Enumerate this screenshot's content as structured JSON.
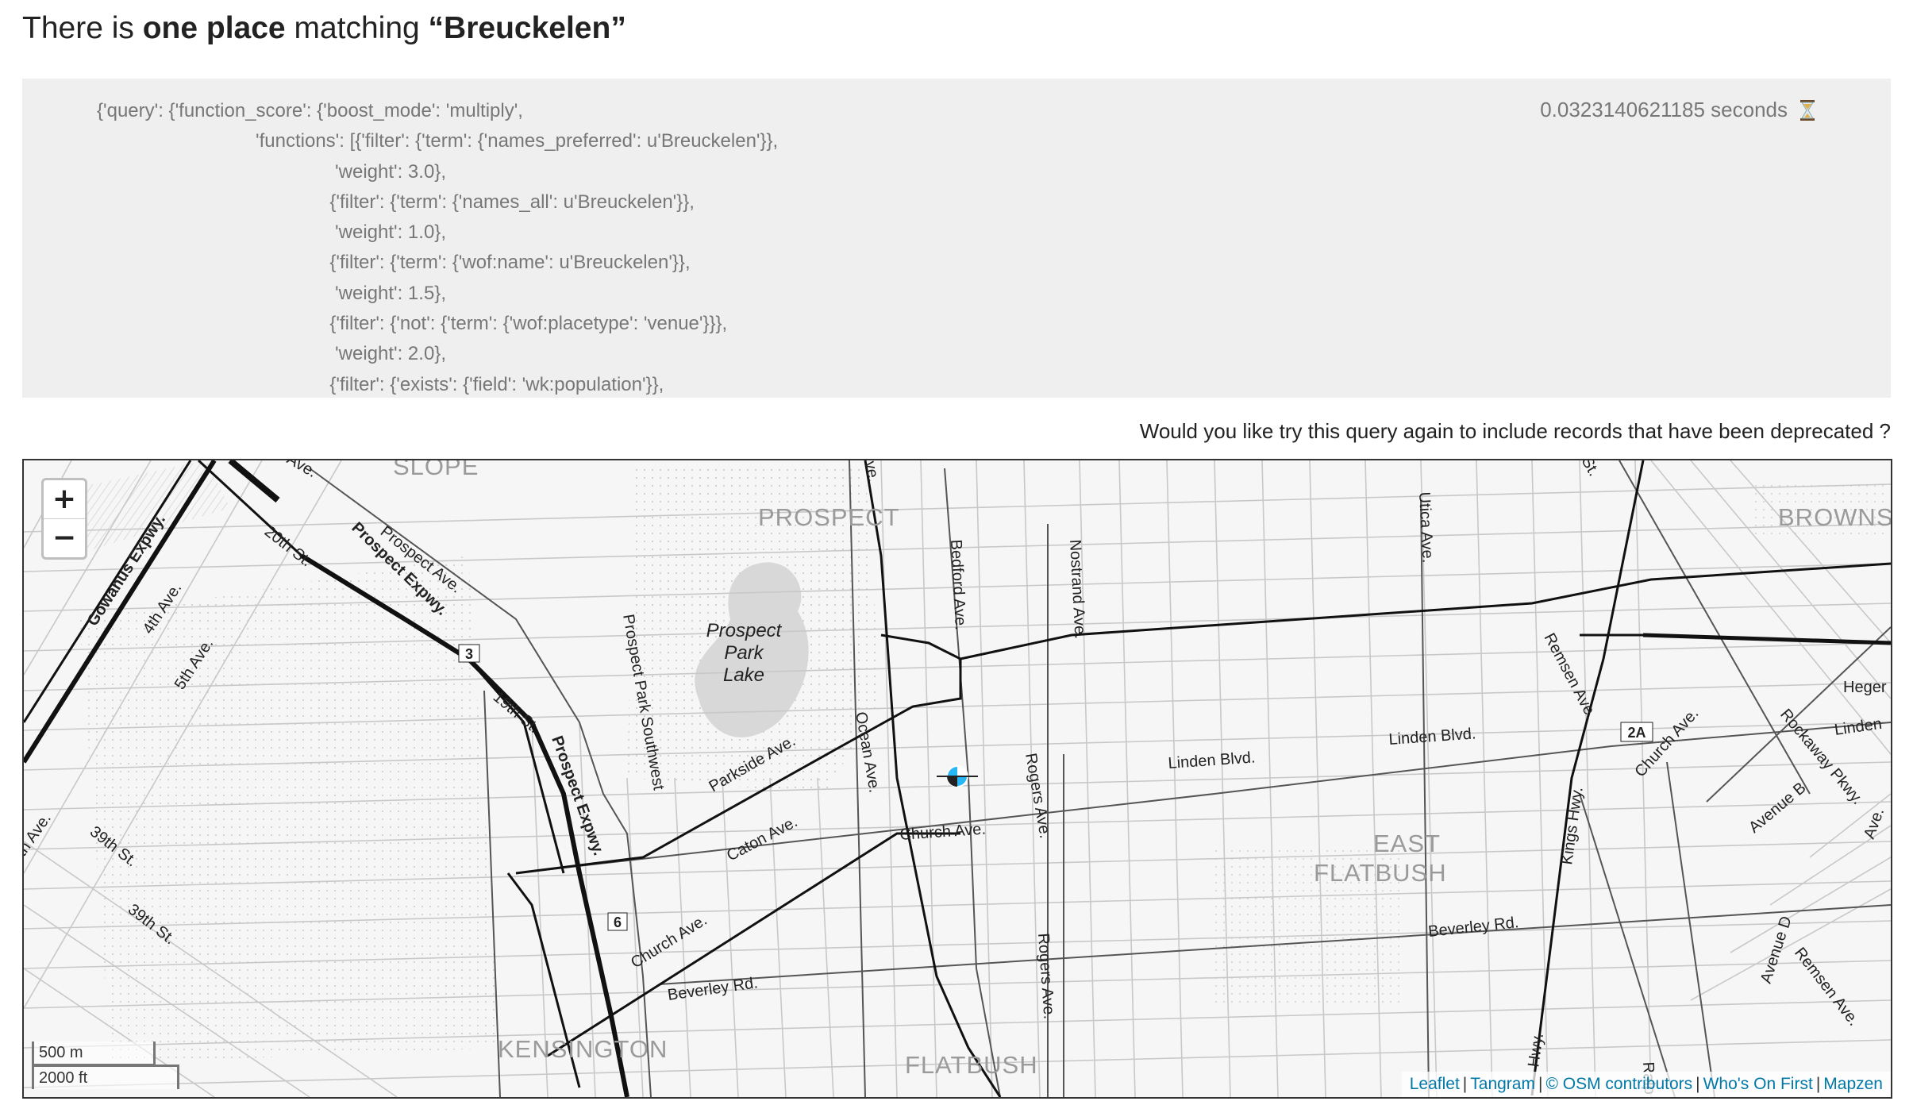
{
  "header": {
    "prefix": "There is ",
    "count": "one place",
    "middle": " matching ",
    "term": "“Breuckelen”"
  },
  "query": {
    "lines": [
      "{'query': {'function_score': {'boost_mode': 'multiply',",
      "                              'functions': [{'filter': {'term': {'names_preferred': u'Breuckelen'}},",
      "                                             'weight': 3.0},",
      "                                            {'filter': {'term': {'names_all': u'Breuckelen'}},",
      "                                             'weight': 1.0},",
      "                                            {'filter': {'term': {'wof:name': u'Breuckelen'}},",
      "                                             'weight': 1.5},",
      "                                            {'filter': {'not': {'term': {'wof:placetype': 'venue'}}},",
      "                                             'weight': 2.0},",
      "                                            {'filter': {'exists': {'field': 'wk:population'}},"
    ],
    "timing": "0.0323140621185 seconds",
    "timing_icon": "hourglass-icon"
  },
  "deprecated_prompt": "Would you like try this query again to include records that have been deprecated ?",
  "map": {
    "zoom_in": "+",
    "zoom_out": "−",
    "scale_metric": "500 m",
    "scale_imperial": "2000 ft",
    "attribution": [
      "Leaflet",
      "Tangram",
      "© OSM contributors",
      "Who's On First",
      "Mapzen"
    ],
    "neighborhoods": {
      "slope": "SLOPE",
      "prospect": "PROSPECT",
      "browns": "BROWNS",
      "east_flatbush_1": "EAST",
      "east_flatbush_2": "FLATBUSH",
      "kensington": "KENSINGTON",
      "flatbush": "FLATBUSH"
    },
    "water": {
      "lake_1": "Prospect",
      "lake_2": "Park",
      "lake_3": "Lake"
    },
    "streets": {
      "gowanus": "Gowanus Expwy.",
      "fourth_ave": "4th Ave.",
      "fifth_ave": "5th Ave.",
      "twentieth": "20th St.",
      "prospect_ave": "Prospect Ave.",
      "prospect_expwy_1": "Prospect Expwy.",
      "prospect_expwy_2": "Prospect Expwy.",
      "nineteenth": "19th St.",
      "prospect_park_sw": "Prospect Park Southwest",
      "parkside": "Parkside Ave.",
      "ocean_ave": "Ocean Ave.",
      "bedford_ave": "Bedford Ave.",
      "nostrand_ave": "Nostrand Ave.",
      "utica_ave": "Utica Ave.",
      "remsen_ave_1": "Remsen Ave.",
      "remsen_ave_2": "Remsen Ave.",
      "linden_1": "Linden Blvd.",
      "linden_2": "Linden Blvd.",
      "linden_3": "Linden",
      "church_1": "Church Ave.",
      "church_2": "Church Ave.",
      "church_3": "Church Ave.",
      "caton": "Caton Ave.",
      "rogers_1": "Rogers Ave.",
      "rogers_2": "Rogers Ave.",
      "beverley_1": "Beverley Rd.",
      "beverley_2": "Beverley Rd.",
      "kings_hwy_1": "Kings Hwy.",
      "kings_hwy_2": "Hwy.",
      "rockaway": "Rockaway Pkwy.",
      "avenue_b": "Avenue B",
      "avenue_d": "Avenue D",
      "heger": "Heger",
      "thirty_ninth_1": "39th St.",
      "thirty_ninth_2": "39th St.",
      "th_ave": "th Ave.",
      "ralp": "Ralp",
      "ave_edge": "Ave.",
      "st_top": "St.",
      "ve_top": "ve.",
      "ave_top_left": "Ave."
    },
    "shields": {
      "exit_3": "3",
      "exit_6": "6",
      "exit_2a": "2A"
    }
  }
}
